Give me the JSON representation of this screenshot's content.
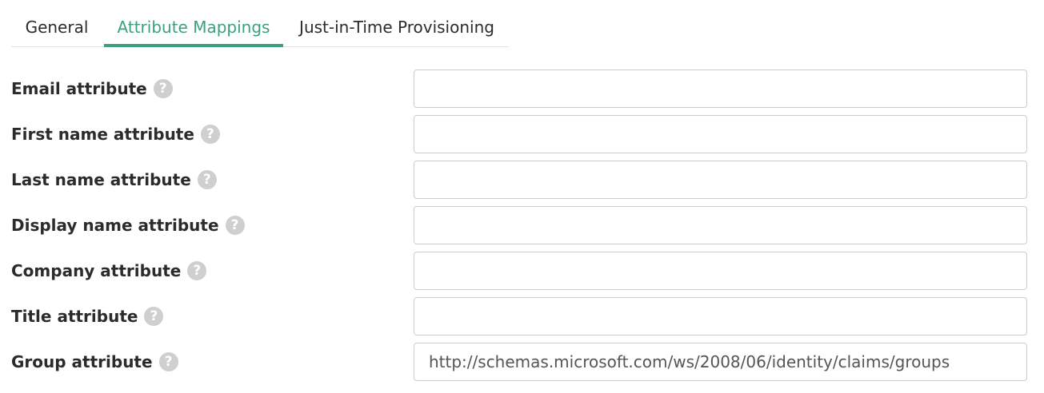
{
  "tabs": [
    {
      "label": "General",
      "active": false
    },
    {
      "label": "Attribute Mappings",
      "active": true
    },
    {
      "label": "Just-in-Time Provisioning",
      "active": false
    }
  ],
  "colors": {
    "accent": "#3c9f7f",
    "help_icon": "#cfcfcf",
    "border": "#cccccc"
  },
  "fields": [
    {
      "label": "Email attribute",
      "value": "",
      "icon": "help-icon"
    },
    {
      "label": "First name attribute",
      "value": "",
      "icon": "help-icon"
    },
    {
      "label": "Last name attribute",
      "value": "",
      "icon": "help-icon"
    },
    {
      "label": "Display name attribute",
      "value": "",
      "icon": "help-icon"
    },
    {
      "label": "Company attribute",
      "value": "",
      "icon": "help-icon"
    },
    {
      "label": "Title attribute",
      "value": "",
      "icon": "help-icon"
    },
    {
      "label": "Group attribute",
      "value": "http://schemas.microsoft.com/ws/2008/06/identity/claims/groups",
      "icon": "help-icon"
    }
  ]
}
